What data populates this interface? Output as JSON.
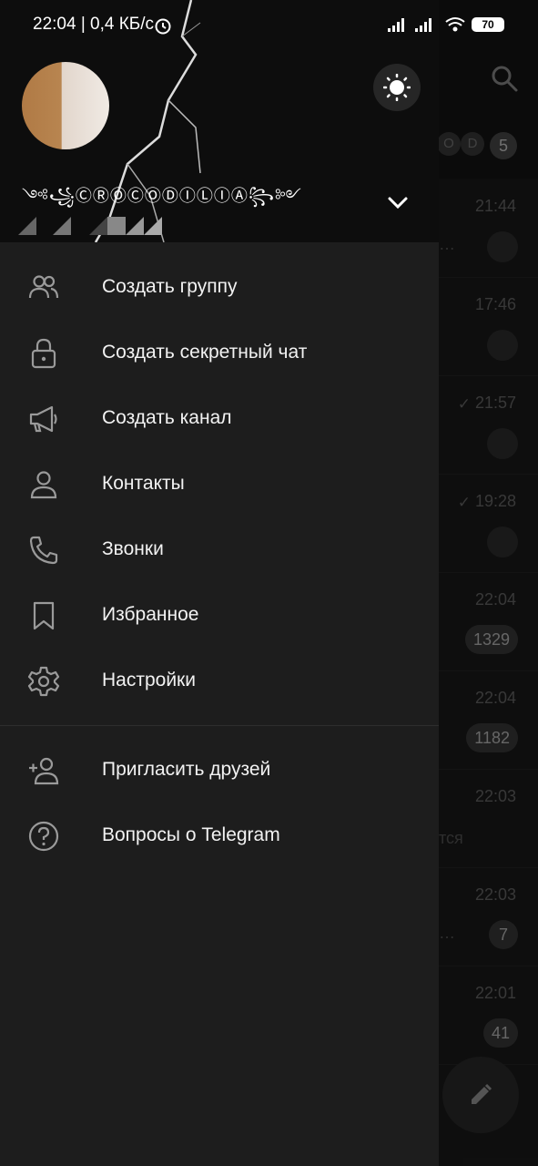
{
  "status_bar": {
    "time_and_speed": "22:04 | 0,4 КБ/с",
    "battery": "70"
  },
  "drawer": {
    "username": "༺꧁ⒸⓇⓄⒸⓄⒹⒾⓁⒾⒶ꧂༻",
    "menu": [
      {
        "label": "Создать группу",
        "icon": "group-icon"
      },
      {
        "label": "Создать секретный чат",
        "icon": "lock-icon"
      },
      {
        "label": "Создать канал",
        "icon": "megaphone-icon"
      },
      {
        "label": "Контакты",
        "icon": "person-icon"
      },
      {
        "label": "Звонки",
        "icon": "phone-icon"
      },
      {
        "label": "Избранное",
        "icon": "bookmark-icon"
      },
      {
        "label": "Настройки",
        "icon": "gear-icon"
      }
    ],
    "menu_secondary": [
      {
        "label": "Пригласить друзей",
        "icon": "add-person-icon"
      },
      {
        "label": "Вопросы о Telegram",
        "icon": "question-icon"
      }
    ]
  },
  "chat_list": {
    "filter_count": "5",
    "filter_chip_text": "D",
    "rows": [
      {
        "time": "21:44",
        "pinned": true
      },
      {
        "time": "17:46",
        "pinned": true
      },
      {
        "time": "21:57",
        "pinned": true,
        "read": true
      },
      {
        "time": "19:28",
        "pinned": true,
        "read": true
      },
      {
        "time": "22:04",
        "badge": "1329"
      },
      {
        "time": "22:04",
        "badge": "1182"
      },
      {
        "time": "22:03",
        "preview": "тся"
      },
      {
        "time": "22:03",
        "badge": "7"
      },
      {
        "time": "22:01",
        "badge": "41"
      }
    ]
  }
}
